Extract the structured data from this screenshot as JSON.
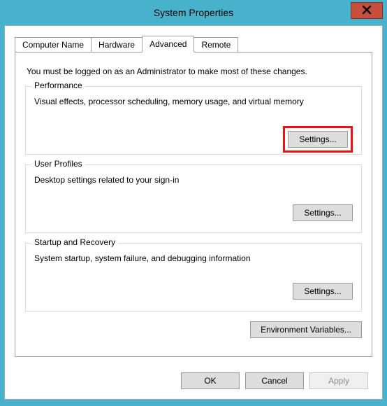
{
  "window": {
    "title": "System Properties"
  },
  "tabs": {
    "computer_name": "Computer Name",
    "hardware": "Hardware",
    "advanced": "Advanced",
    "remote": "Remote"
  },
  "advanced_panel": {
    "intro": "You must be logged on as an Administrator to make most of these changes.",
    "performance": {
      "title": "Performance",
      "desc": "Visual effects, processor scheduling, memory usage, and virtual memory",
      "button": "Settings..."
    },
    "user_profiles": {
      "title": "User Profiles",
      "desc": "Desktop settings related to your sign-in",
      "button": "Settings..."
    },
    "startup": {
      "title": "Startup and Recovery",
      "desc": "System startup, system failure, and debugging information",
      "button": "Settings..."
    },
    "env_button": "Environment Variables..."
  },
  "buttons": {
    "ok": "OK",
    "cancel": "Cancel",
    "apply": "Apply"
  }
}
